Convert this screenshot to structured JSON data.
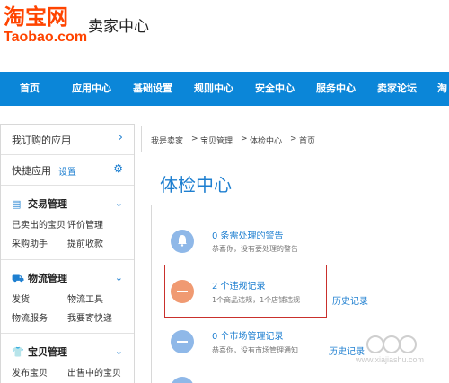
{
  "header": {
    "logo_cn": "淘宝网",
    "logo_en": "Taobao.com",
    "title": "卖家中心"
  },
  "nav": {
    "items": [
      "首页",
      "应用中心",
      "基础设置",
      "规则中心",
      "安全中心",
      "服务中心",
      "卖家论坛",
      "淘"
    ]
  },
  "sidebar": {
    "my_apps": "我订购的应用",
    "quick_apps": "快捷应用",
    "settings": "设置",
    "sections": [
      {
        "title": "交易管理",
        "icon": "document-icon",
        "links": [
          "已卖出的宝贝",
          "评价管理",
          "采购助手",
          "提前收款"
        ]
      },
      {
        "title": "物流管理",
        "icon": "truck-icon",
        "links": [
          "发货",
          "物流工具",
          "物流服务",
          "我要寄快递"
        ]
      },
      {
        "title": "宝贝管理",
        "icon": "shirt-icon",
        "links": [
          "发布宝贝",
          "出售中的宝贝"
        ]
      }
    ]
  },
  "breadcrumb": [
    "我是卖家",
    ">",
    "宝贝管理",
    ">",
    "体检中心",
    ">",
    "首页"
  ],
  "main": {
    "title": "体检中心",
    "items": [
      {
        "title": "0 条需处理的警告",
        "desc": "恭喜你，没有要处理的警告",
        "history": ""
      },
      {
        "title": "2 个违规记录",
        "desc": "1个商品违规，1个店铺违规",
        "history": "历史记录"
      },
      {
        "title": "0 个市场管理记录",
        "desc": "恭喜你，没有市场管理通知",
        "history": "历史记录"
      }
    ]
  },
  "watermark": {
    "text": "www.xiajiashu.com"
  },
  "colors": {
    "accent": "#0b86d8",
    "brand": "#ff4400",
    "link": "#1e7fd0",
    "alert": "#c9302c"
  }
}
